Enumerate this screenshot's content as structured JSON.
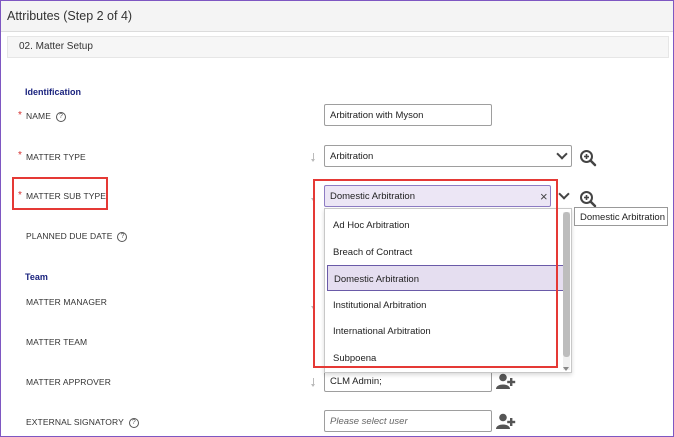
{
  "window": {
    "title": "Attributes (Step 2 of 4)"
  },
  "section": {
    "label": "02. Matter Setup"
  },
  "groups": {
    "identification": "Identification",
    "team": "Team"
  },
  "fields": {
    "name": {
      "label": "NAME",
      "required": "*",
      "help": "?",
      "value": "Arbitration with Myson"
    },
    "matter_type": {
      "label": "MATTER TYPE",
      "required": "*",
      "value": "Arbitration"
    },
    "matter_sub_type": {
      "label": "MATTER SUB TYPE",
      "required": "*",
      "value": "Domestic Arbitration",
      "clear": "×"
    },
    "planned_due_date": {
      "label": "PLANNED DUE DATE",
      "help": "?"
    },
    "matter_manager": {
      "label": "MATTER MANAGER"
    },
    "matter_team": {
      "label": "MATTER TEAM"
    },
    "matter_approver": {
      "label": "MATTER APPROVER",
      "value": "CLM Admin;"
    },
    "external_signatory": {
      "label": "EXTERNAL SIGNATORY",
      "help": "?",
      "placeholder": "Please select user"
    }
  },
  "dropdown": {
    "options": [
      "Ad Hoc Arbitration",
      "Breach of Contract",
      "Domestic Arbitration",
      "Institutional Arbitration",
      "International Arbitration",
      "Subpoena"
    ],
    "selected_index": 2
  },
  "tooltip": {
    "text": "Domestic Arbitration"
  },
  "icons": {
    "zoom": "magnifier-plus-icon",
    "user_add": "user-add-icon",
    "sort": "sort-arrow-icon",
    "chevron": "chevron-down-icon",
    "help": "help-circle-icon"
  },
  "colors": {
    "required": "#d32f2f",
    "group_heading": "#1a237e",
    "highlight": "#e53935",
    "selected_bg": "#e5def0",
    "frame": "#7e57c2"
  }
}
